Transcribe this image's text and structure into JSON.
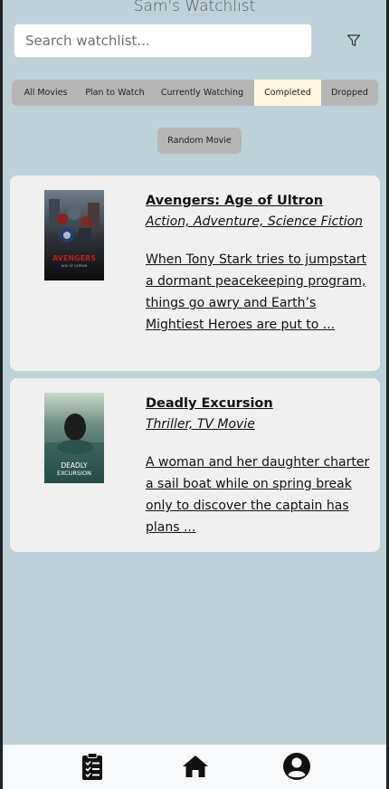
{
  "header": {
    "title": "Sam's Watchlist"
  },
  "search": {
    "placeholder": "Search watchlist...",
    "value": ""
  },
  "filter": {
    "icon": "filter-icon"
  },
  "tabs": [
    {
      "label": "All Movies",
      "active": false
    },
    {
      "label": "Plan to Watch",
      "active": false
    },
    {
      "label": "Currently Watching",
      "active": false
    },
    {
      "label": "Completed",
      "active": true
    },
    {
      "label": "Dropped",
      "active": false
    }
  ],
  "random_button": {
    "label": "Random Movie"
  },
  "movies": [
    {
      "title": "Avengers: Age of Ultron",
      "genres": "Action, Adventure, Science Fiction",
      "description": "When Tony Stark tries to jumpstart a dormant peacekeeping program, things go awry and Earth’s Mightiest Heroes are put to ...",
      "poster_text": "AVENGERS",
      "poster_subtext": "AGE OF ULTRON"
    },
    {
      "title": "Deadly Excursion",
      "genres": "Thriller, TV Movie",
      "description": "A woman and her daughter charter a sail boat while on spring break only to discover the captain has plans ...",
      "poster_text": "DEADLY",
      "poster_subtext": "EXCURSION"
    }
  ],
  "bottom_nav": [
    {
      "icon": "clipboard-list-icon"
    },
    {
      "icon": "home-icon"
    },
    {
      "icon": "user-circle-icon"
    }
  ],
  "colors": {
    "background": "#bdd1d8",
    "card": "#f0f0f0",
    "tab_bar": "#b6b6b6",
    "tab_active": "#fdf5de",
    "nav_bar": "#f6f8f9"
  }
}
